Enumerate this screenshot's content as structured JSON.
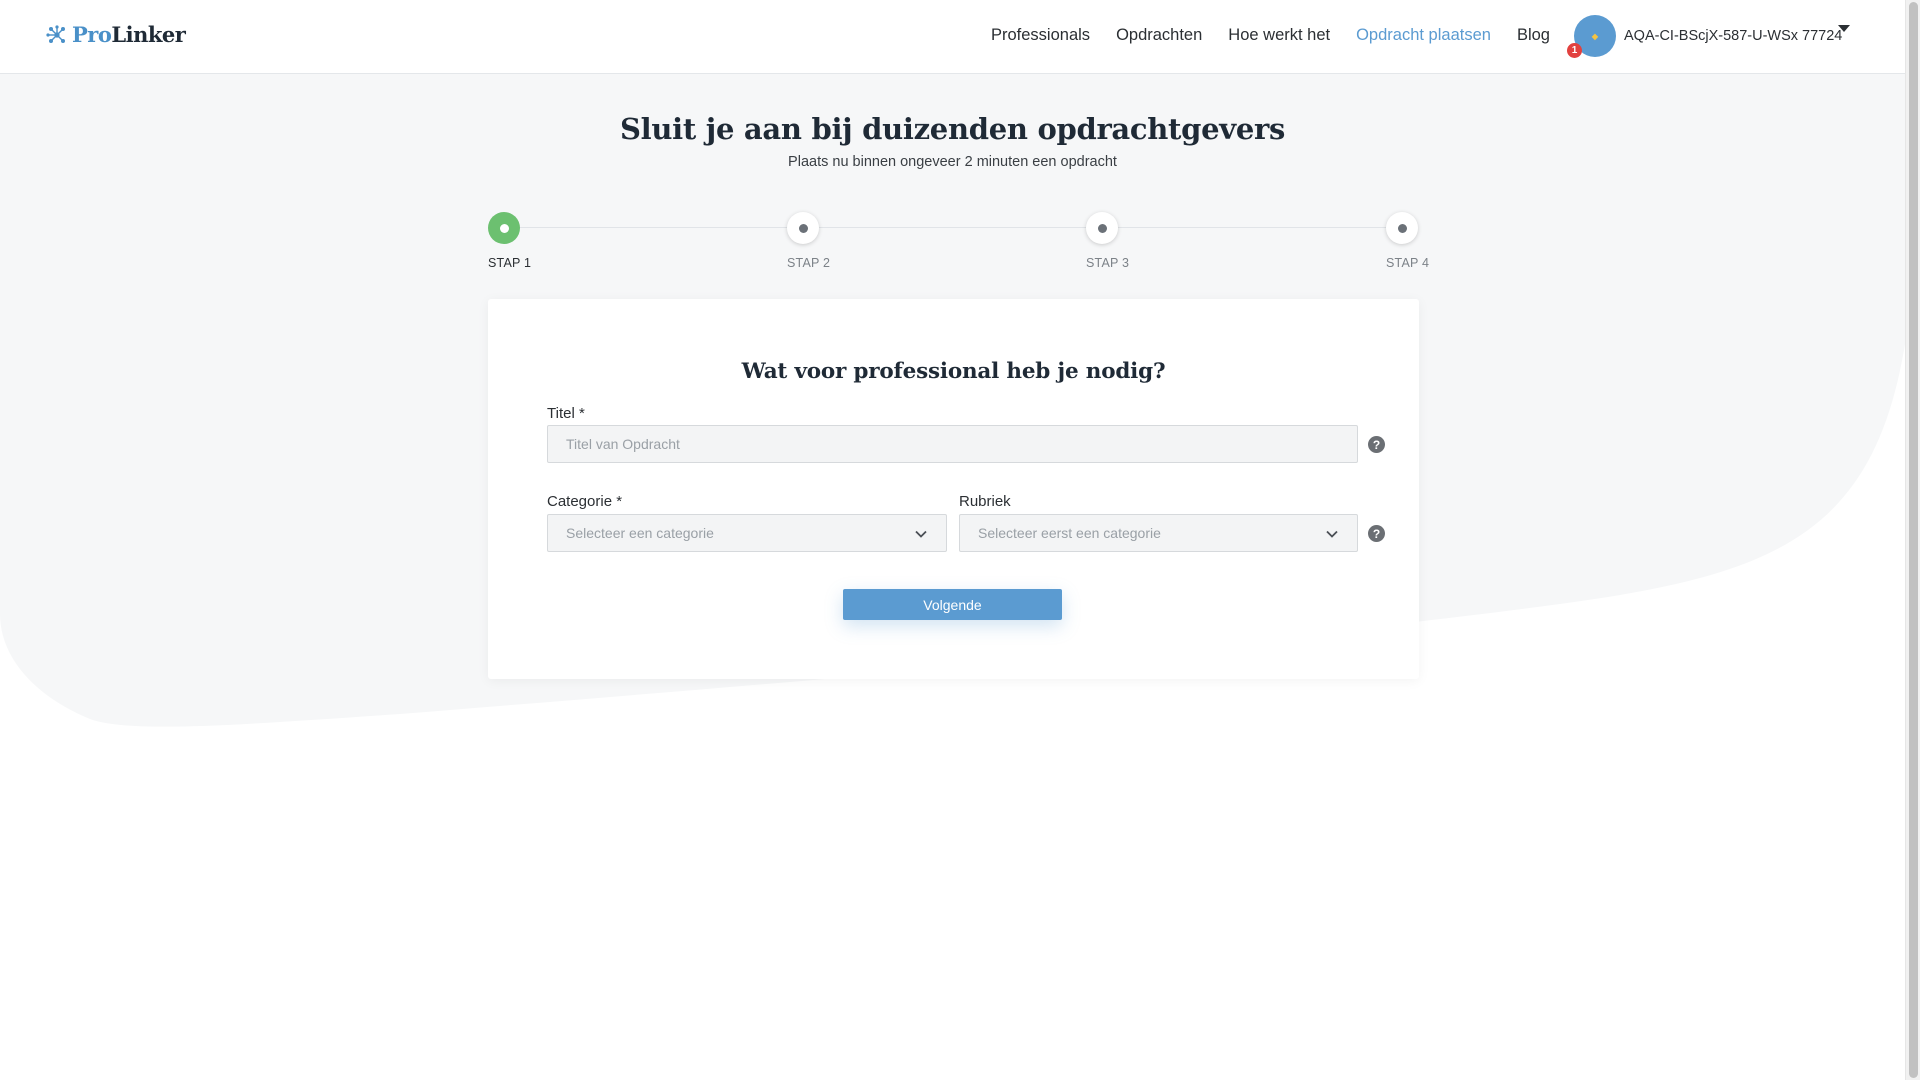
{
  "brand": {
    "logo_icon": "network-icon",
    "name_part1": "Pro",
    "name_part2": "Linker"
  },
  "nav": {
    "items": [
      {
        "label": "Professionals",
        "active": false
      },
      {
        "label": "Opdrachten",
        "active": false
      },
      {
        "label": "Hoe werkt het",
        "active": false
      },
      {
        "label": "Opdracht plaatsen",
        "active": true
      },
      {
        "label": "Blog",
        "active": false
      }
    ]
  },
  "user": {
    "name": "AQA-CI-BScjX-587-U-WSx 77724",
    "notification_count": "1",
    "avatar_color": "#5b9bd1"
  },
  "hero": {
    "title": "Sluit je aan bij duizenden opdrachtgevers",
    "subtitle": "Plaats nu binnen ongeveer 2 minuten een opdracht"
  },
  "stepper": {
    "steps": [
      {
        "label": "STAP 1",
        "active": true
      },
      {
        "label": "STAP 2",
        "active": false
      },
      {
        "label": "STAP 3",
        "active": false
      },
      {
        "label": "STAP 4",
        "active": false
      }
    ]
  },
  "form": {
    "title": "Wat voor professional heb je nodig?",
    "titel_label": "Titel *",
    "titel_placeholder": "Titel van Opdracht",
    "titel_value": "",
    "categorie_label": "Categorie *",
    "categorie_placeholder": "Selecteer een categorie",
    "rubriek_label": "Rubriek",
    "rubriek_placeholder": "Selecteer eerst een categorie",
    "help_glyph": "?",
    "next_label": "Volgende"
  },
  "colors": {
    "accent": "#5b9bd1",
    "step_active": "#6cc070",
    "badge": "#e2413f",
    "background_shape": "#f6f7f8"
  }
}
